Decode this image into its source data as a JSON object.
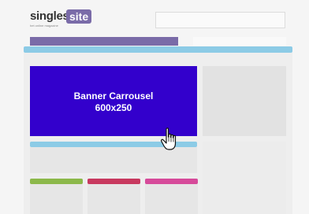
{
  "logo": {
    "part1": "singles",
    "part2": "site",
    "tagline": "het online magazine"
  },
  "banner": {
    "title": "Banner Carrousel",
    "size": "600x250"
  },
  "colors": {
    "banner": "#3300cc",
    "nav_bar": "#8ccbe6",
    "purple_tab": "#7a6ba8",
    "col1_accent": "#8cb84a",
    "col2_accent": "#c8395f",
    "col3_accent": "#d64a9a"
  },
  "cursor": {
    "icon": "hand-pointer-icon"
  }
}
